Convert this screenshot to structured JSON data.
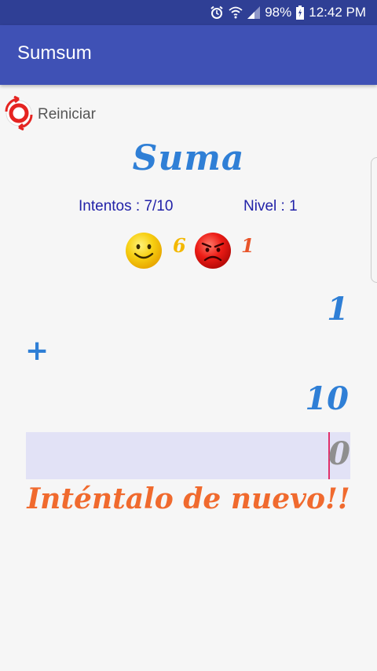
{
  "status_bar": {
    "battery": "98%",
    "time": "12:42 PM",
    "icons": [
      "alarm-icon",
      "wifi-icon",
      "signal-icon",
      "battery-icon"
    ]
  },
  "app_bar": {
    "title": "Sumsum",
    "color": "#3f51b5"
  },
  "reset": {
    "label": "Reiniciar",
    "icon": "refresh-icon"
  },
  "game": {
    "title": "Suma",
    "attempts": "Intentos : 7/10",
    "level": "Nivel : 1",
    "correct_count": "6",
    "wrong_count": "1",
    "operand_1": "1",
    "operator": "+",
    "operand_2": "10",
    "answer_placeholder": "0",
    "feedback": "Inténtalo de nuevo!!"
  },
  "colors": {
    "accent": "#2f7fd6",
    "feedback": "#f06a2e",
    "happy": "#f3c300",
    "sad": "#e81a1a"
  }
}
